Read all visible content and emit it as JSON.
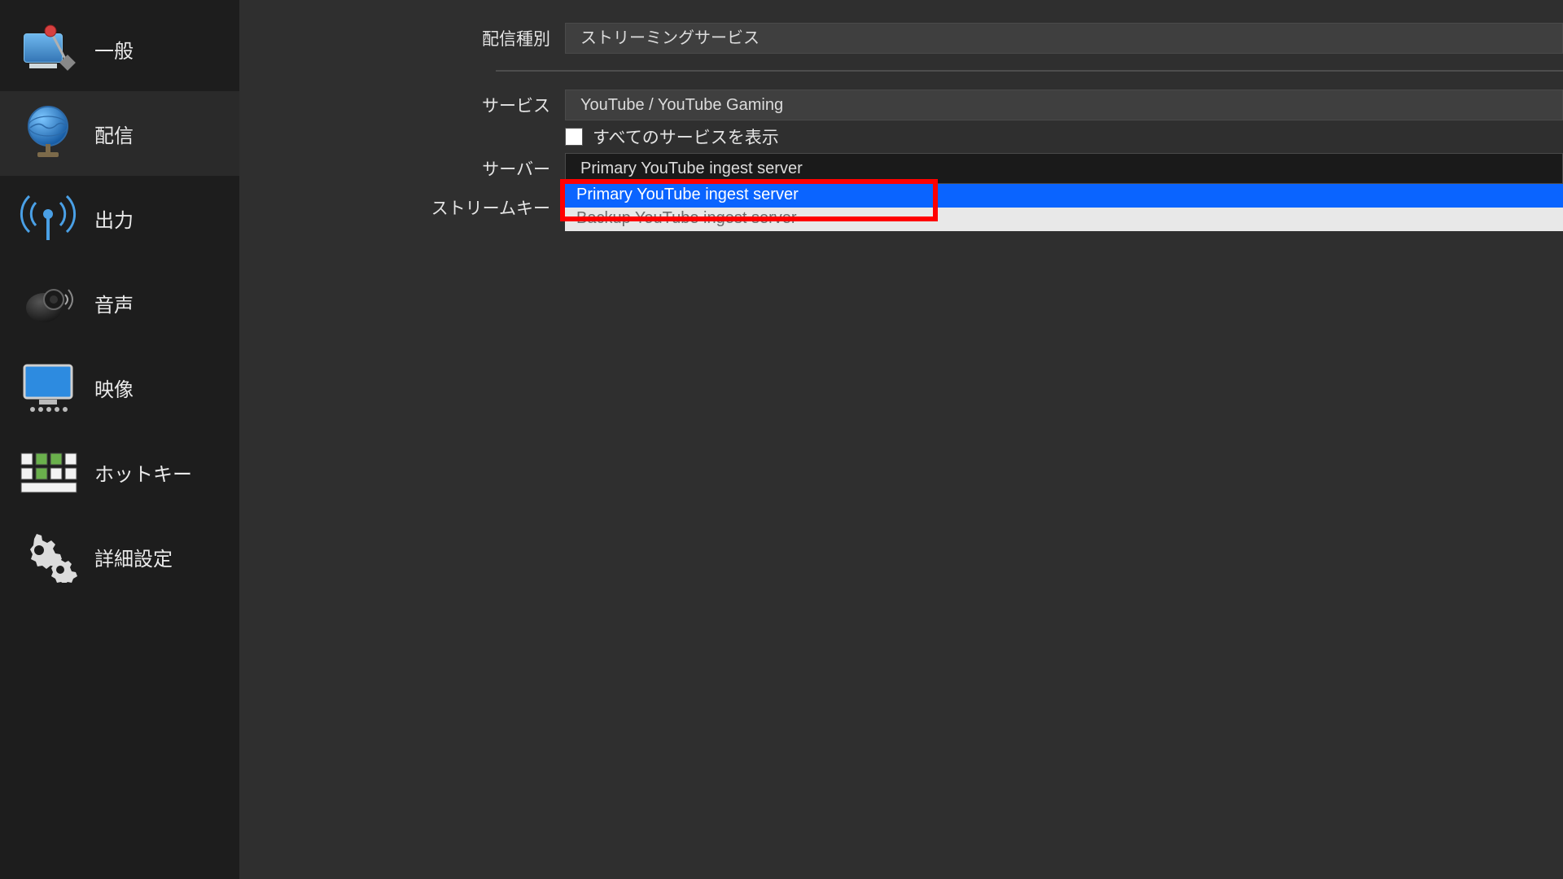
{
  "sidebar": {
    "items": [
      {
        "label": "一般"
      },
      {
        "label": "配信"
      },
      {
        "label": "出力"
      },
      {
        "label": "音声"
      },
      {
        "label": "映像"
      },
      {
        "label": "ホットキー"
      },
      {
        "label": "詳細設定"
      }
    ],
    "selectedIndex": 1
  },
  "form": {
    "streamTypeLabel": "配信種別",
    "streamTypeValue": "ストリーミングサービス",
    "serviceLabel": "サービス",
    "serviceValue": "YouTube / YouTube Gaming",
    "showAllLabel": "すべてのサービスを表示",
    "showAllChecked": false,
    "serverLabel": "サーバー",
    "serverValue": "Primary YouTube ingest server",
    "serverOptions": [
      "Primary YouTube ingest server",
      "Backup YouTube ingest server"
    ],
    "serverHighlightedIndex": 0,
    "streamKeyLabel": "ストリームキー"
  }
}
